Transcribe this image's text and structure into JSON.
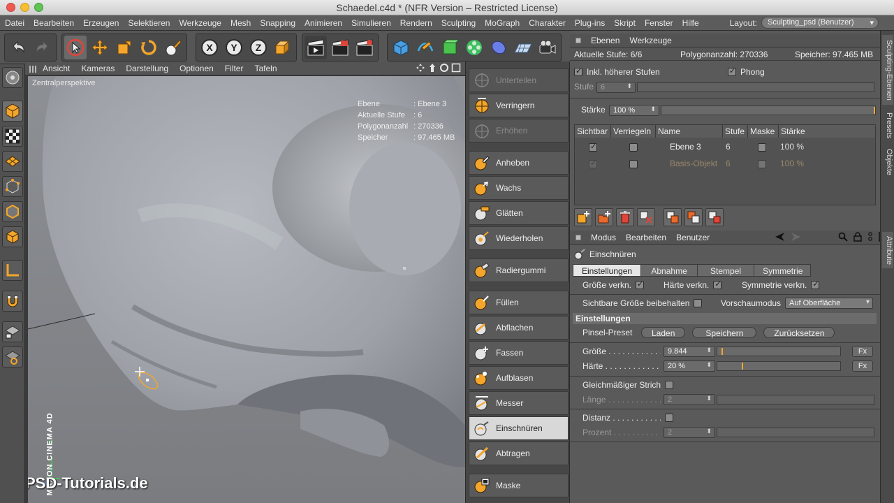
{
  "window": {
    "title": "Schaedel.c4d * (NFR Version – Restricted License)"
  },
  "menubar": {
    "items": [
      "Datei",
      "Bearbeiten",
      "Erzeugen",
      "Selektieren",
      "Werkzeuge",
      "Mesh",
      "Snapping",
      "Animieren",
      "Simulieren",
      "Rendern",
      "Sculpting",
      "MoGraph",
      "Charakter",
      "Plug-ins",
      "Skript",
      "Fenster",
      "Hilfe"
    ],
    "layout_label": "Layout:",
    "layout_value": "Sculpting_psd (Benutzer)"
  },
  "viewport": {
    "menu": [
      "Ansicht",
      "Kameras",
      "Darstellung",
      "Optionen",
      "Filter",
      "Tafeln"
    ],
    "camera_label": "Zentralperspektive",
    "hud": [
      {
        "key": "Ebene",
        "value": ": Ebene 3"
      },
      {
        "key": "Aktuelle Stufe",
        "value": ": 6"
      },
      {
        "key": "Polygonanzahl",
        "value": ": 270336"
      },
      {
        "key": "Speicher",
        "value": ": 97.465 MB"
      }
    ],
    "watermark": "PSD-Tutorials.de",
    "logo": "MAXON CINEMA 4D",
    "axis_y": "Y"
  },
  "brushes": [
    {
      "label": "Unterteilen",
      "state": "disabled",
      "icon": "subdivide-icon"
    },
    {
      "label": "Verringern",
      "state": "normal",
      "icon": "decrease-icon"
    },
    {
      "label": "Erhöhen",
      "state": "disabled",
      "icon": "increase-icon"
    },
    {
      "label": "Anheben",
      "state": "normal",
      "icon": "pull-brush-icon"
    },
    {
      "label": "Wachs",
      "state": "normal",
      "icon": "wax-brush-icon"
    },
    {
      "label": "Glätten",
      "state": "normal",
      "icon": "smooth-brush-icon"
    },
    {
      "label": "Wiederholen",
      "state": "normal",
      "icon": "repeat-brush-icon"
    },
    {
      "label": "Radiergummi",
      "state": "normal",
      "icon": "eraser-brush-icon"
    },
    {
      "label": "Füllen",
      "state": "normal",
      "icon": "fill-brush-icon"
    },
    {
      "label": "Abflachen",
      "state": "normal",
      "icon": "flatten-brush-icon"
    },
    {
      "label": "Fassen",
      "state": "normal",
      "icon": "grab-brush-icon"
    },
    {
      "label": "Aufblasen",
      "state": "normal",
      "icon": "inflate-brush-icon"
    },
    {
      "label": "Messer",
      "state": "normal",
      "icon": "knife-brush-icon"
    },
    {
      "label": "Einschnüren",
      "state": "active",
      "icon": "pinch-brush-icon"
    },
    {
      "label": "Abtragen",
      "state": "normal",
      "icon": "scrape-brush-icon"
    },
    {
      "label": "Maske",
      "state": "normal",
      "icon": "mask-brush-icon"
    }
  ],
  "layers_panel": {
    "tabs": [
      "Ebenen",
      "Werkzeuge"
    ],
    "current_level": "Aktuelle Stufe: 6/6",
    "polycount": "Polygonanzahl: 270336",
    "memory": "Speicher: 97.465 MB",
    "incl_higher": "Inkl. höherer Stufen",
    "phong": "Phong",
    "stufe_label": "Stufe",
    "stufe_value": "6",
    "staerke_label": "Stärke",
    "staerke_value": "100 %",
    "columns": [
      "Sichtbar",
      "Verriegeln",
      "Name",
      "Stufe",
      "Maske",
      "Stärke"
    ],
    "rows": [
      {
        "visible": true,
        "locked": false,
        "name": "Ebene 3",
        "level": "6",
        "mask": false,
        "strength": "100 %",
        "dim": false
      },
      {
        "visible": true,
        "locked": false,
        "name": "Basis-Objekt",
        "level": "6",
        "mask": false,
        "strength": "100 %",
        "dim": true
      }
    ]
  },
  "attributes": {
    "menu": [
      "Modus",
      "Bearbeiten",
      "Benutzer"
    ],
    "tool_name": "Einschnüren",
    "tabs": [
      "Einstellungen",
      "Abnahme",
      "Stempel",
      "Symmetrie"
    ],
    "link_size": "Größe verkn.",
    "link_hardness": "Härte verkn.",
    "link_symmetry": "Symmetrie verkn.",
    "keep_visible_size": "Sichtbare Größe beibehalten",
    "preview_mode_label": "Vorschaumodus",
    "preview_mode_value": "Auf Oberfläche",
    "section_title": "Einstellungen",
    "preset_label": "Pinsel-Preset",
    "preset_load": "Laden",
    "preset_save": "Speichern",
    "preset_reset": "Zurücksetzen",
    "size_label": "Größe . . . . . . . . . . . . .",
    "size_value": "9.844",
    "size_fraction": 0.035,
    "hardness_label": "Härte . . . . . . . . . . . . .",
    "hardness_value": "20 %",
    "hardness_fraction": 0.2,
    "fx_label": "Fx",
    "even_stroke": "Gleichmäßiger Strich",
    "length_label": "Länge . . . . . . . . . . . . .",
    "length_value": "2",
    "distance_label": "Distanz . . . . . . . . . . .",
    "percent_label": "Prozent . . . . . . . . . . .",
    "percent_value": "2"
  },
  "side_tabs": [
    "Sculpting-Ebenen",
    "Presets",
    "Objekte",
    "Attribute"
  ],
  "colors": {
    "accent": "#f1a72e",
    "panel": "#5a5a5a",
    "active_tab": "#e6e6e6"
  }
}
